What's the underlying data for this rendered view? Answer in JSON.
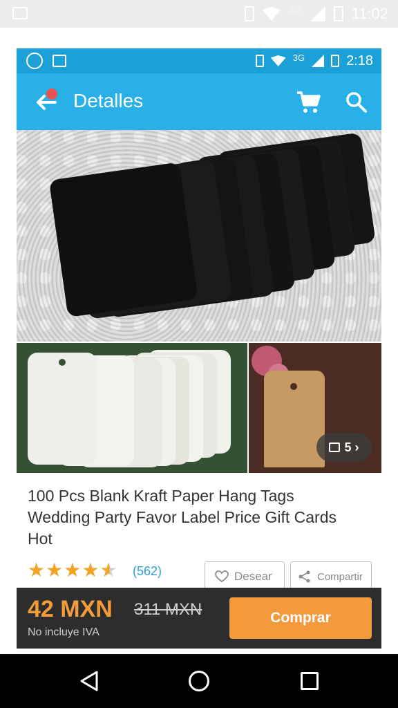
{
  "outer_status": {
    "network": "3G",
    "time": "11:02"
  },
  "inner_status": {
    "network": "3G",
    "time": "2:18"
  },
  "appbar": {
    "title": "Detalles"
  },
  "gallery": {
    "image_count_label": "5 ›"
  },
  "product": {
    "title": "100 Pcs Blank Kraft Paper Hang Tags Wedding Party Favor Label Price Gift Cards Hot",
    "rating": 4.5,
    "reviews": "(562)",
    "wish_label": "Desear",
    "share_label": "Compartir"
  },
  "buybar": {
    "price": "42 MXN",
    "old_price": "311 MXN",
    "tax_note": "No incluye IVA",
    "buy_label": "Comprar"
  },
  "icons": {
    "outer": [
      "image-icon",
      "vibrate-icon",
      "wifi-icon",
      "signal-icon",
      "battery-icon"
    ],
    "inner": [
      "whatsapp-icon",
      "image-icon",
      "vibrate-icon",
      "wifi-icon",
      "signal-icon",
      "battery-icon"
    ],
    "appbar": [
      "back-arrow-icon",
      "cart-icon",
      "search-icon"
    ],
    "nav": [
      "back-icon",
      "home-icon",
      "recents-icon"
    ]
  },
  "colors": {
    "appbar": "#2ab0e8",
    "status": "#1ba1d8",
    "price": "#f49b3a",
    "buy_button": "#f39a3c",
    "rating": "#f4a225",
    "link": "#2a9fd6"
  }
}
